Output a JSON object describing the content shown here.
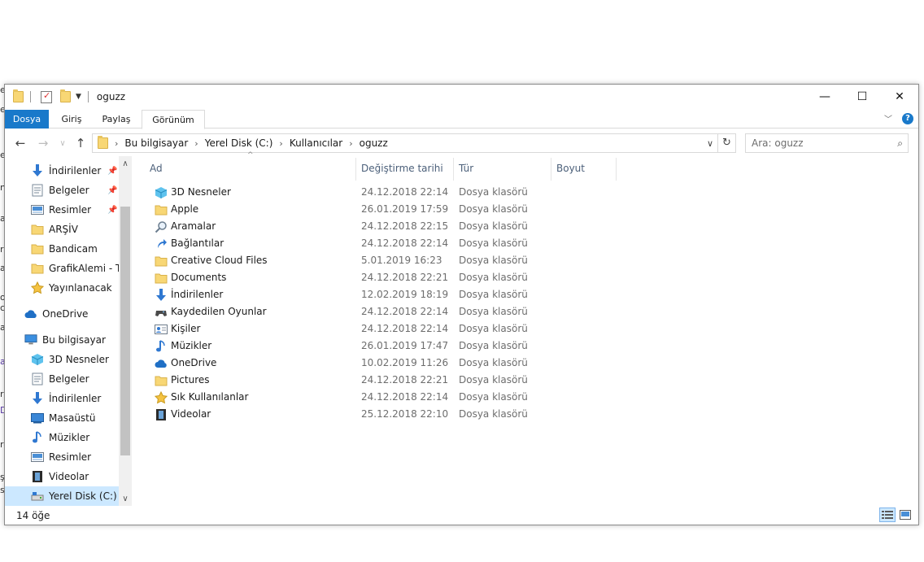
{
  "window": {
    "title": "oguzz",
    "controls": [
      "—",
      "☐",
      "✕"
    ]
  },
  "ribbon": {
    "tabs": [
      {
        "label": "Dosya",
        "active": true
      },
      {
        "label": "Giriş"
      },
      {
        "label": "Paylaş"
      },
      {
        "label": "Görünüm"
      }
    ]
  },
  "address": {
    "crumbs": [
      "Bu bilgisayar",
      "Yerel Disk (C:)",
      "Kullanıcılar",
      "oguzz"
    ]
  },
  "search": {
    "placeholder": "Ara: oguzz"
  },
  "nav": {
    "items": [
      {
        "label": "İndirilenler",
        "icon": "download-icon",
        "pinned": true
      },
      {
        "label": "Belgeler",
        "icon": "document-icon",
        "pinned": true
      },
      {
        "label": "Resimler",
        "icon": "picture-icon",
        "pinned": true
      },
      {
        "label": "ARŞİV",
        "icon": "folder-icon"
      },
      {
        "label": "Bandicam",
        "icon": "folder-icon"
      },
      {
        "label": "GrafikAlemi - TE",
        "icon": "folder-icon"
      },
      {
        "label": "Yayınlanacak",
        "icon": "star-icon"
      },
      {
        "label": "OneDrive",
        "icon": "cloud-icon"
      },
      {
        "label": "Bu bilgisayar",
        "icon": "computer-icon"
      },
      {
        "label": "3D Nesneler",
        "icon": "cube-icon"
      },
      {
        "label": "Belgeler",
        "icon": "document-icon"
      },
      {
        "label": "İndirilenler",
        "icon": "download-icon"
      },
      {
        "label": "Masaüstü",
        "icon": "desktop-icon"
      },
      {
        "label": "Müzikler",
        "icon": "music-icon"
      },
      {
        "label": "Resimler",
        "icon": "picture-icon"
      },
      {
        "label": "Videolar",
        "icon": "video-icon"
      },
      {
        "label": "Yerel Disk (C:)",
        "icon": "drive-icon",
        "selected": true
      }
    ]
  },
  "columns": [
    "Ad",
    "Değiştirme tarihi",
    "Tür",
    "Boyut"
  ],
  "files": [
    {
      "name": "3D Nesneler",
      "date": "24.12.2018 22:14",
      "type": "Dosya klasörü",
      "icon": "cube-icon"
    },
    {
      "name": "Apple",
      "date": "26.01.2019 17:59",
      "type": "Dosya klasörü",
      "icon": "folder-icon"
    },
    {
      "name": "Aramalar",
      "date": "24.12.2018 22:15",
      "type": "Dosya klasörü",
      "icon": "search-icon"
    },
    {
      "name": "Bağlantılar",
      "date": "24.12.2018 22:14",
      "type": "Dosya klasörü",
      "icon": "link-icon"
    },
    {
      "name": "Creative Cloud Files",
      "date": "5.01.2019 16:23",
      "type": "Dosya klasörü",
      "icon": "folder-icon"
    },
    {
      "name": "Documents",
      "date": "24.12.2018 22:21",
      "type": "Dosya klasörü",
      "icon": "folder-icon"
    },
    {
      "name": "İndirilenler",
      "date": "12.02.2019 18:19",
      "type": "Dosya klasörü",
      "icon": "download-icon"
    },
    {
      "name": "Kaydedilen Oyunlar",
      "date": "24.12.2018 22:14",
      "type": "Dosya klasörü",
      "icon": "gamepad-icon"
    },
    {
      "name": "Kişiler",
      "date": "24.12.2018 22:14",
      "type": "Dosya klasörü",
      "icon": "contacts-icon"
    },
    {
      "name": "Müzikler",
      "date": "26.01.2019 17:47",
      "type": "Dosya klasörü",
      "icon": "music-icon"
    },
    {
      "name": "OneDrive",
      "date": "10.02.2019 11:26",
      "type": "Dosya klasörü",
      "icon": "cloud-icon"
    },
    {
      "name": "Pictures",
      "date": "24.12.2018 22:21",
      "type": "Dosya klasörü",
      "icon": "folder-icon"
    },
    {
      "name": "Sık Kullanılanlar",
      "date": "24.12.2018 22:14",
      "type": "Dosya klasörü",
      "icon": "star-icon"
    },
    {
      "name": "Videolar",
      "date": "25.12.2018 22:10",
      "type": "Dosya klasörü",
      "icon": "video-icon"
    }
  ],
  "status": {
    "count": "14 öğe"
  },
  "background_fragments": [
    "e",
    "e",
    "e",
    "n",
    "a",
    "r",
    "a",
    "o",
    "c",
    "a",
    "at",
    "ra",
    "D",
    "re",
    "ş",
    "si"
  ],
  "colors": {
    "accent": "#1979ca",
    "selection": "#cce8ff",
    "header_text": "#4c607a",
    "folder": "#f8d775"
  }
}
